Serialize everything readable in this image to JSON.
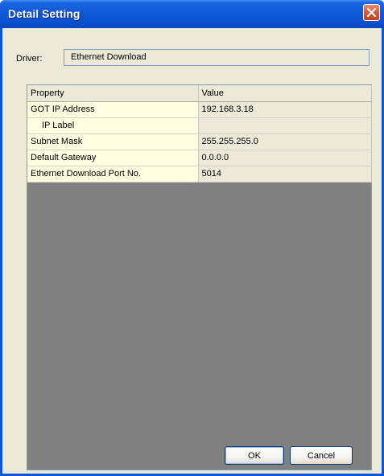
{
  "window": {
    "title": "Detail Setting"
  },
  "driver": {
    "label": "Driver:",
    "value": "Ethernet Download"
  },
  "table": {
    "columns": [
      "Property",
      "Value"
    ],
    "rows": [
      {
        "property": "GOT IP Address",
        "value": "192.168.3.18"
      },
      {
        "property": "IP Label",
        "value": ""
      },
      {
        "property": "Subnet Mask",
        "value": "255.255.255.0"
      },
      {
        "property": "Default Gateway",
        "value": "0.0.0.0"
      },
      {
        "property": "Ethernet Download Port No.",
        "value": "5014"
      }
    ]
  },
  "buttons": {
    "ok_label": "OK",
    "cancel_label": "Cancel"
  }
}
